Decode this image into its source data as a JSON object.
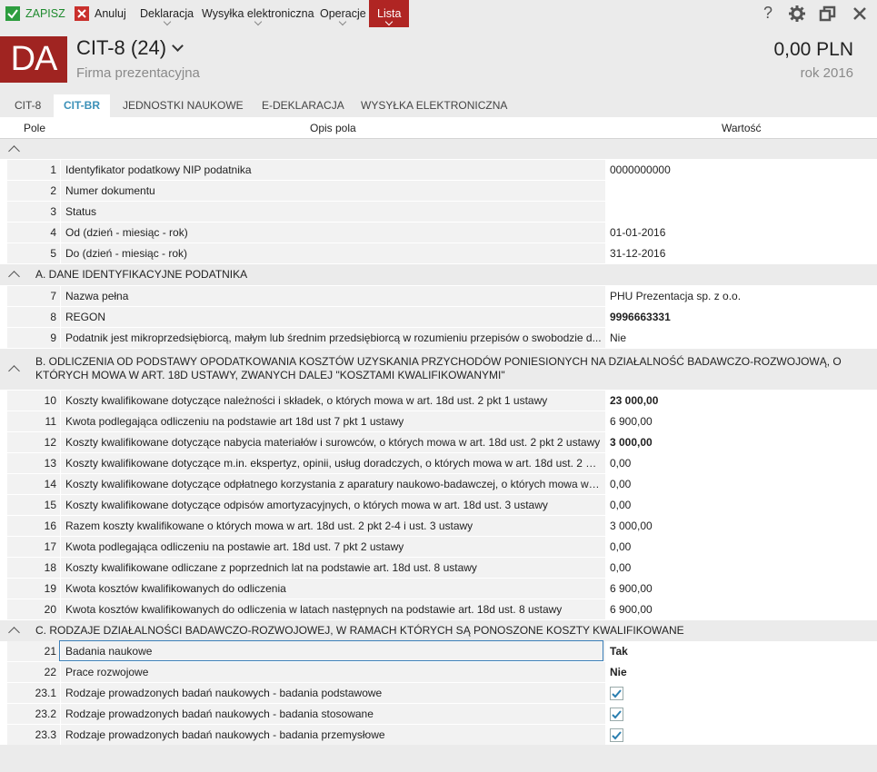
{
  "toolbar": {
    "save": "ZAPISZ",
    "cancel": "Anuluj",
    "declaration": "Deklaracja",
    "e_sending": "Wysyłka elektroniczna",
    "operations": "Operacje",
    "list": "Lista",
    "help": "?"
  },
  "header": {
    "logo": "DA",
    "title": "CIT-8 (24)",
    "company": "Firma prezentacyjna",
    "amount": "0,00 PLN",
    "year": "rok 2016"
  },
  "tabs": [
    "CIT-8",
    "CIT-BR",
    "JEDNOSTKI NAUKOWE",
    "E-DEKLARACJA",
    "WYSYŁKA ELEKTRONICZNA"
  ],
  "columns": {
    "field": "Pole",
    "desc": "Opis pola",
    "value": "Wartość"
  },
  "sections": {
    "a": "A. DANE IDENTYFIKACYJNE PODATNIKA",
    "b": "B. ODLICZENIA OD PODSTAWY OPODATKOWANIA KOSZTÓW UZYSKANIA PRZYCHODÓW PONIESIONYCH NA DZIAŁALNOŚĆ BADAWCZO-ROZWOJOWĄ, O KTÓRYCH MOWA W ART. 18D USTAWY, ZWANYCH DALEJ \"KOSZTAMI KWALIFIKOWANYMI\"",
    "c": "C. RODZAJE DZIAŁALNOŚCI BADAWCZO-ROZWOJOWEJ, W RAMACH KTÓRYCH SĄ PONOSZONE KOSZTY KWALIFIKOWANE"
  },
  "rows": [
    {
      "num": "1",
      "desc": "Identyfikator podatkowy NIP podatnika",
      "value": "0000000000"
    },
    {
      "num": "2",
      "desc": "Numer dokumentu",
      "value": ""
    },
    {
      "num": "3",
      "desc": "Status",
      "value": ""
    },
    {
      "num": "4",
      "desc": "Od (dzień - miesiąc - rok)",
      "value": "01-01-2016"
    },
    {
      "num": "5",
      "desc": "Do (dzień - miesiąc - rok)",
      "value": "31-12-2016"
    },
    {
      "num": "7",
      "desc": "Nazwa pełna",
      "value": "PHU Prezentacja sp. z o.o."
    },
    {
      "num": "8",
      "desc": "REGON",
      "value": "9996663331"
    },
    {
      "num": "9",
      "desc": "Podatnik jest mikroprzedsiębiorcą, małym lub średnim przedsiębiorcą w rozumieniu przepisów o swobodzie d...",
      "value": "Nie"
    },
    {
      "num": "10",
      "desc": "Koszty kwalifikowane dotyczące należności i składek, o których mowa w art. 18d ust. 2 pkt 1 ustawy",
      "value": "23 000,00"
    },
    {
      "num": "11",
      "desc": "Kwota podlegająca odliczeniu na podstawie art 18d ust 7 pkt 1 ustawy",
      "value": "6 900,00"
    },
    {
      "num": "12",
      "desc": "Koszty kwalifikowane dotyczące nabycia materiałów i surowców, o których mowa w art. 18d ust. 2 pkt 2 ustawy",
      "value": "3 000,00"
    },
    {
      "num": "13",
      "desc": "Koszty kwalifikowane dotyczące m.in. ekspertyz, opinii, usług doradczych, o których mowa w art. 18d ust. 2 pk...",
      "value": "0,00"
    },
    {
      "num": "14",
      "desc": "Koszty kwalifikowane dotyczące odpłatnego korzystania z aparatury naukowo-badawczej, o których mowa w a...",
      "value": "0,00"
    },
    {
      "num": "15",
      "desc": "Koszty kwalifikowane dotyczące odpisów amortyzacyjnych, o których mowa w art. 18d ust. 3 ustawy",
      "value": "0,00"
    },
    {
      "num": "16",
      "desc": "Razem koszty kwalifikowane o których mowa w art. 18d ust. 2 pkt 2-4 i ust. 3 ustawy",
      "value": "3 000,00"
    },
    {
      "num": "17",
      "desc": "Kwota podlegająca odliczeniu na postawie art. 18d ust. 7 pkt 2 ustawy",
      "value": "0,00"
    },
    {
      "num": "18",
      "desc": "Koszty kwalifikowane odliczane z poprzednich lat na podstawie art. 18d ust. 8 ustawy",
      "value": "0,00"
    },
    {
      "num": "19",
      "desc": "Kwota kosztów kwalifikowanych do odliczenia",
      "value": "6 900,00"
    },
    {
      "num": "20",
      "desc": "Kwota kosztów kwalifikowanych do odliczenia w latach następnych na podstawie art. 18d ust. 8 ustawy",
      "value": "6 900,00"
    },
    {
      "num": "21",
      "desc": "Badania naukowe",
      "value": "Tak"
    },
    {
      "num": "22",
      "desc": "Prace rozwojowe",
      "value": "Nie"
    },
    {
      "num": "23.1",
      "desc": "Rodzaje prowadzonych badań naukowych - badania podstawowe",
      "checked": true
    },
    {
      "num": "23.2",
      "desc": "Rodzaje prowadzonych badań naukowych - badania stosowane",
      "checked": true
    },
    {
      "num": "23.3",
      "desc": "Rodzaje prowadzonych badań naukowych - badania przemysłowe",
      "checked": true
    }
  ]
}
